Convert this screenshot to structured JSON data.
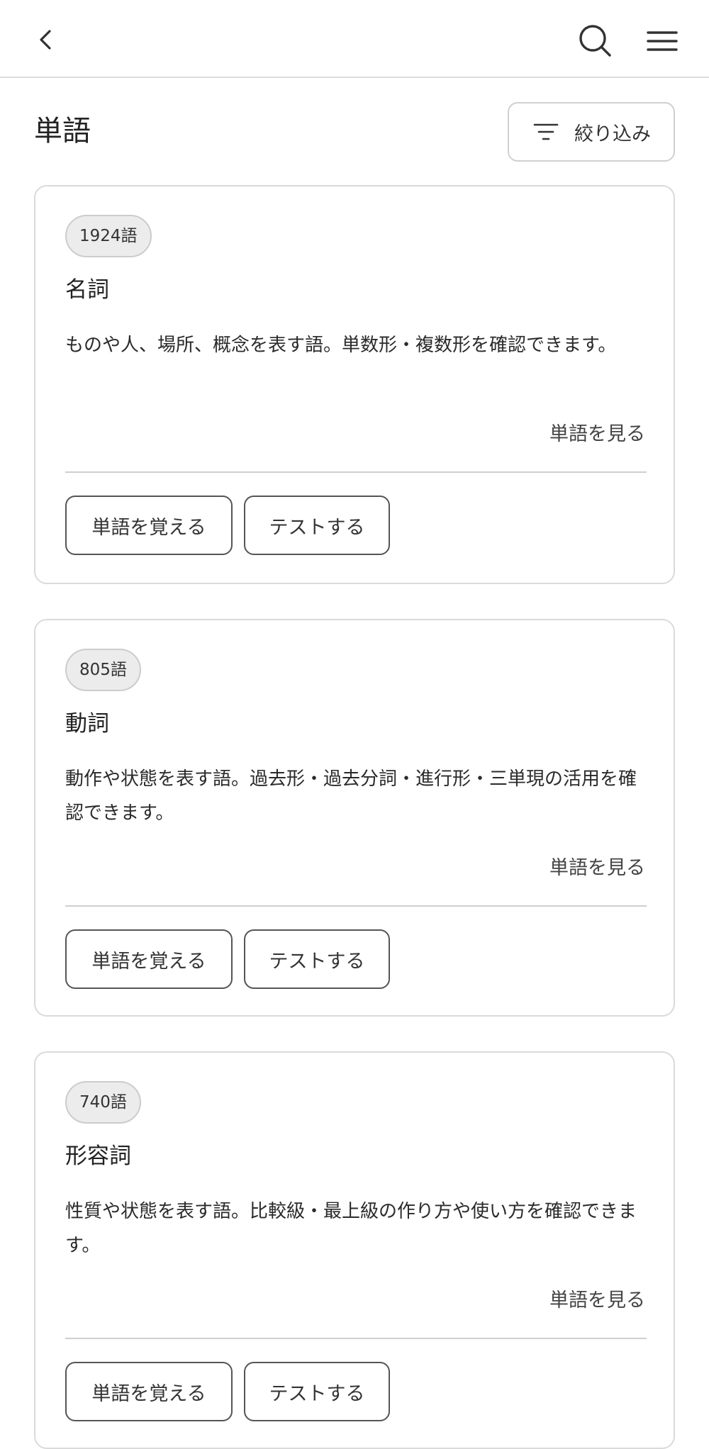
{
  "header": {
    "back_icon": "chevron-left-icon",
    "search_icon": "search-icon",
    "menu_icon": "hamburger-menu-icon"
  },
  "page": {
    "title": "単語",
    "filter": {
      "label": "絞り込み",
      "icon": "filter-icon"
    }
  },
  "cards": [
    {
      "count": "1924語",
      "title": "名詞",
      "description": "ものや人、場所、概念を表す語。単数形・複数形を確認できます。",
      "view_link": "単語を見る",
      "learn_label": "単語を覚える",
      "test_label": "テストする"
    },
    {
      "count": "805語",
      "title": "動詞",
      "description": "動作や状態を表す語。過去形・過去分詞・進行形・三単現の活用を確認できます。",
      "view_link": "単語を見る",
      "learn_label": "単語を覚える",
      "test_label": "テストする"
    },
    {
      "count": "740語",
      "title": "形容詞",
      "description": "性質や状態を表す語。比較級・最上級の作り方や使い方を確認できます。",
      "view_link": "単語を見る",
      "learn_label": "単語を覚える",
      "test_label": "テストする"
    }
  ]
}
